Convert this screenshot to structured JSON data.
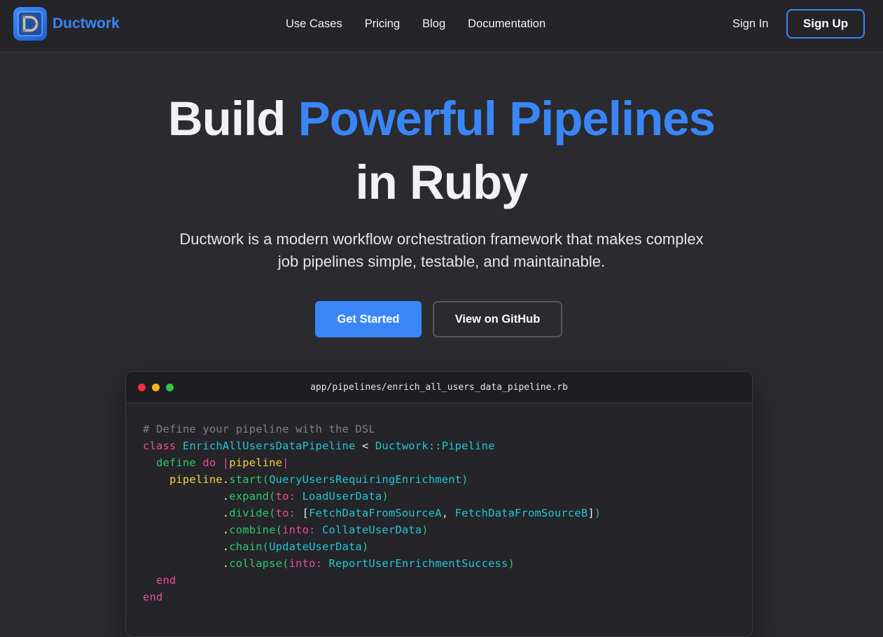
{
  "nav": {
    "brand": "Ductwork",
    "links": [
      "Use Cases",
      "Pricing",
      "Blog",
      "Documentation"
    ],
    "sign_in": "Sign In",
    "sign_up": "Sign Up"
  },
  "hero": {
    "title_part1": "Build ",
    "title_accent": "Powerful Pipelines",
    "title_part2": "in Ruby",
    "subtitle": "Ductwork is a modern workflow orchestration framework that makes complex job pipelines simple, testable, and maintainable.",
    "primary_cta": "Get Started",
    "secondary_cta": "View on GitHub"
  },
  "code_window": {
    "filename": "app/pipelines/enrich_all_users_data_pipeline.rb",
    "lines": [
      [
        [
          "c-com",
          "# Define your pipeline with the DSL"
        ]
      ],
      [
        [
          "c-kw",
          "class "
        ],
        [
          "c-cls",
          "EnrichAllUsersDataPipeline"
        ],
        [
          "c-pl",
          " < "
        ],
        [
          "c-cls",
          "Ductwork::Pipeline"
        ]
      ],
      [
        [
          "c-pl",
          "  "
        ],
        [
          "c-def",
          "define "
        ],
        [
          "c-kw",
          "do "
        ],
        [
          "c-kw",
          "|"
        ],
        [
          "c-var",
          "pipeline"
        ],
        [
          "c-kw",
          "|"
        ]
      ],
      [
        [
          "c-pl",
          "    "
        ],
        [
          "c-var",
          "pipeline"
        ],
        [
          "c-pl",
          "."
        ],
        [
          "c-mth",
          "start("
        ],
        [
          "c-cls",
          "QueryUsersRequiringEnrichment"
        ],
        [
          "c-mth",
          ")"
        ]
      ],
      [
        [
          "c-pl",
          "            ."
        ],
        [
          "c-mth",
          "expand("
        ],
        [
          "c-sym",
          "to: "
        ],
        [
          "c-cls",
          "LoadUserData"
        ],
        [
          "c-mth",
          ")"
        ]
      ],
      [
        [
          "c-pl",
          "            ."
        ],
        [
          "c-mth",
          "divide("
        ],
        [
          "c-sym",
          "to: "
        ],
        [
          "c-pl",
          "["
        ],
        [
          "c-cls",
          "FetchDataFromSourceA"
        ],
        [
          "c-pl",
          ", "
        ],
        [
          "c-cls",
          "FetchDataFromSourceB"
        ],
        [
          "c-pl",
          "]"
        ],
        [
          "c-mth",
          ")"
        ]
      ],
      [
        [
          "c-pl",
          "            ."
        ],
        [
          "c-mth",
          "combine("
        ],
        [
          "c-sym",
          "into: "
        ],
        [
          "c-cls",
          "CollateUserData"
        ],
        [
          "c-mth",
          ")"
        ]
      ],
      [
        [
          "c-pl",
          "            ."
        ],
        [
          "c-mth",
          "chain("
        ],
        [
          "c-cls",
          "UpdateUserData"
        ],
        [
          "c-mth",
          ")"
        ]
      ],
      [
        [
          "c-pl",
          "            ."
        ],
        [
          "c-mth",
          "collapse("
        ],
        [
          "c-sym",
          "into: "
        ],
        [
          "c-cls",
          "ReportUserEnrichmentSuccess"
        ],
        [
          "c-mth",
          ")"
        ]
      ],
      [
        [
          "c-pl",
          "  "
        ],
        [
          "c-kw",
          "end"
        ]
      ],
      [
        [
          "c-kw",
          "end"
        ]
      ]
    ]
  }
}
